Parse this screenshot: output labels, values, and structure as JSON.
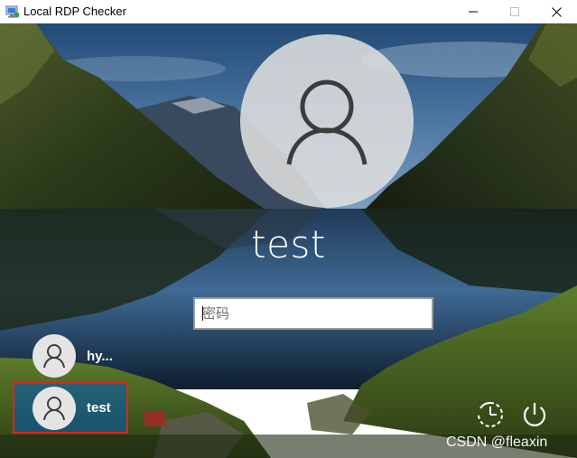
{
  "window": {
    "title": "Local RDP Checker",
    "controls": [
      "minimize",
      "maximize",
      "close"
    ]
  },
  "lockscreen": {
    "selected_user": "test",
    "password": {
      "placeholder": "密码",
      "value": ""
    },
    "users": [
      {
        "name": "hy...",
        "selected": false
      },
      {
        "name": "test",
        "selected": true
      }
    ],
    "icons": {
      "ease_of_access": "ease-of-access-icon",
      "power": "power-icon"
    }
  },
  "watermark": "CSDN @fleaxin",
  "colors": {
    "selection_border": "#e82020",
    "selected_user_bg": "#005ab4",
    "avatar_bg": "#dedede"
  }
}
